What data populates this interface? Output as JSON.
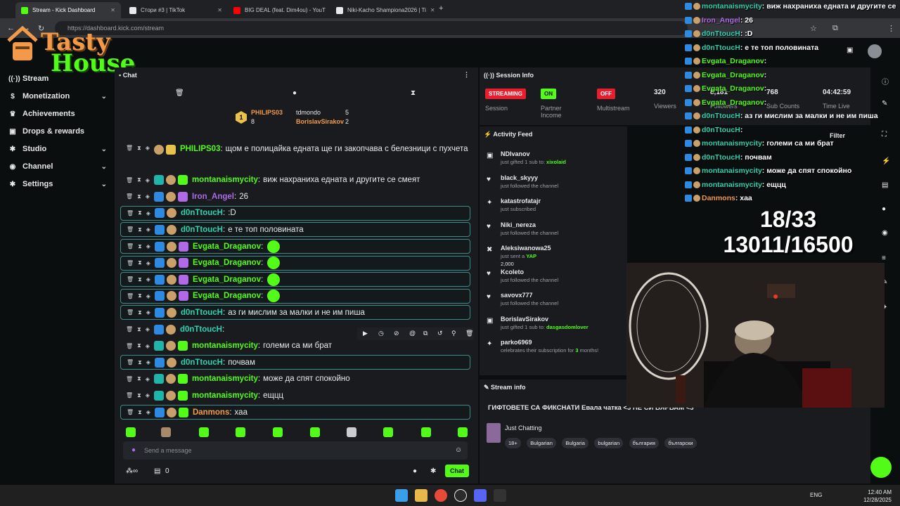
{
  "browser": {
    "tabs": [
      {
        "title": "Stream - Kick Dashboard",
        "color": "#53fc18"
      },
      {
        "title": "Стори #3 | TikTok",
        "color": "#e7e9ea"
      },
      {
        "title": "BIG DEAL (feat. Dim4ou) - YouT",
        "color": "#ff0000"
      },
      {
        "title": "Niki-Kacho Shampiona2026 | Ti",
        "color": "#e7e9ea"
      }
    ],
    "url": "https://dashboard.kick.com/stream"
  },
  "logo": {
    "line1": "Tasty",
    "line2": "House"
  },
  "sidebar": {
    "items": [
      {
        "label": "Stream",
        "icon": "broadcast-icon",
        "glyph": "((·))",
        "chevron": false
      },
      {
        "label": "Monetization",
        "icon": "dollar-icon",
        "glyph": "$",
        "chevron": true
      },
      {
        "label": "Achievements",
        "icon": "trophy-icon",
        "glyph": "♛",
        "chevron": false
      },
      {
        "label": "Drops & rewards",
        "icon": "gift-icon",
        "glyph": "▣",
        "chevron": false
      },
      {
        "label": "Studio",
        "icon": "gear-icon",
        "glyph": "✱",
        "chevron": true
      },
      {
        "label": "Channel",
        "icon": "gamepad-icon",
        "glyph": "◉",
        "chevron": true
      },
      {
        "label": "Settings",
        "icon": "settings-icon",
        "glyph": "✱",
        "chevron": true
      }
    ]
  },
  "chat": {
    "title": "Chat",
    "leaderboard": [
      {
        "rank": "1",
        "name": "PHILIPS03",
        "count": "8"
      },
      {
        "name": "tdmondo",
        "count": "5"
      },
      {
        "name": "BorislavSirakov",
        "count": "2"
      }
    ],
    "messages": [
      {
        "user": "PHILIPS03",
        "color": "u-green",
        "text": "щом е полицайка едната ще ги закопчава с белезници с пухчета",
        "hl": false,
        "badges": [
          "b-face",
          "b-gold"
        ]
      },
      {
        "user": "montanaismycity",
        "color": "u-green",
        "text": "виж нахраниха едната и другите се смеят",
        "hl": false,
        "badges": [
          "b-cyan",
          "b-face",
          "b-sub"
        ]
      },
      {
        "user": "Iron_Angel",
        "color": "u-purple",
        "text": "26",
        "hl": false,
        "badges": [
          "b-blue",
          "b-face",
          "b-purp"
        ]
      },
      {
        "user": "d0nTtoucH",
        "color": "u-cyan",
        "text": ":D",
        "hl": true,
        "badges": [
          "b-blue",
          "b-face"
        ]
      },
      {
        "user": "d0nTtoucH",
        "color": "u-cyan",
        "text": "е те топ половината",
        "hl": true,
        "badges": [
          "b-blue",
          "b-face"
        ]
      },
      {
        "user": "Evgata_Draganov",
        "color": "u-green",
        "text": "",
        "emote": true,
        "hl": true,
        "badges": [
          "b-blue",
          "b-face",
          "b-purp"
        ]
      },
      {
        "user": "Evgata_Draganov",
        "color": "u-green",
        "text": "",
        "emote": true,
        "hl": true,
        "badges": [
          "b-blue",
          "b-face",
          "b-purp"
        ]
      },
      {
        "user": "Evgata_Draganov",
        "color": "u-green",
        "text": "",
        "emote": true,
        "hl": true,
        "badges": [
          "b-blue",
          "b-face",
          "b-purp"
        ]
      },
      {
        "user": "Evgata_Draganov",
        "color": "u-green",
        "text": "",
        "emote": true,
        "hl": true,
        "badges": [
          "b-blue",
          "b-face",
          "b-purp"
        ]
      },
      {
        "user": "d0nTtoucH",
        "color": "u-cyan",
        "text": "аз ги мислим за малки и не им пиша",
        "hl": true,
        "badges": [
          "b-blue",
          "b-face"
        ]
      },
      {
        "user": "d0nTtoucH",
        "color": "u-cyan",
        "text": "",
        "hl": false,
        "badges": [
          "b-blue",
          "b-face"
        ]
      },
      {
        "user": "montanaismycity",
        "color": "u-green",
        "text": "големи са ми брат",
        "hl": false,
        "badges": [
          "b-cyan",
          "b-face",
          "b-sub"
        ]
      },
      {
        "user": "d0nTtoucH",
        "color": "u-cyan",
        "text": "почвам",
        "hl": true,
        "badges": [
          "b-blue",
          "b-face"
        ]
      },
      {
        "user": "montanaismycity",
        "color": "u-green",
        "text": "може да спят спокойно",
        "hl": false,
        "badges": [
          "b-cyan",
          "b-face",
          "b-sub"
        ]
      },
      {
        "user": "montanaismycity",
        "color": "u-green",
        "text": "ещцц",
        "hl": false,
        "badges": [
          "b-cyan",
          "b-face",
          "b-sub"
        ]
      },
      {
        "user": "Danmons",
        "color": "u-orange",
        "text": "хаа",
        "hl": true,
        "badges": [
          "b-blue",
          "b-face",
          "b-sub"
        ]
      }
    ],
    "send_placeholder": "Send a message",
    "chat_button": "Chat",
    "cart_count": "0"
  },
  "session": {
    "title": "Session Info",
    "stats": [
      {
        "pill": "STREAMING",
        "pillColor": "#e81e2e",
        "label": "Session"
      },
      {
        "pill": "ON",
        "pillColor": "#53fc18",
        "label": "Partner Income"
      },
      {
        "pill": "OFF",
        "pillColor": "#e81e2e",
        "label": "Multistream"
      },
      {
        "value": "320",
        "label": "Viewers"
      },
      {
        "value": "8,181",
        "label": "Followers"
      },
      {
        "value": "768",
        "label": "Sub Counts"
      },
      {
        "value": "04:42:59",
        "label": "Time Live"
      }
    ]
  },
  "activity": {
    "title": "Activity Feed",
    "filter": "Filter",
    "items": [
      {
        "icon": "gift-icon",
        "glyph": "▣",
        "who": "NDIvanov",
        "what": "just gifted 1 sub to: ",
        "bold": "xixolaid",
        "time": ""
      },
      {
        "icon": "heart-icon",
        "glyph": "♥",
        "who": "black_skyyy",
        "what": "just followed the channel",
        "bold": "",
        "time": "6 minutes ago"
      },
      {
        "icon": "star-icon",
        "glyph": "✦",
        "who": "katastrofatajr",
        "what": "just subscribed",
        "bold": "",
        "time": "32 minutes ago"
      },
      {
        "icon": "heart-icon",
        "glyph": "♥",
        "who": "Niki_nereza",
        "what": "just followed the channel",
        "bold": "",
        "time": "33 minutes ago"
      },
      {
        "icon": "kick-icon",
        "glyph": "✖",
        "who": "Aleksiwanowa25",
        "what": "just sent a ",
        "bold": "YAP",
        "extra": "2,000",
        "time": "1 hour ago"
      },
      {
        "icon": "heart-icon",
        "glyph": "♥",
        "who": "Kcoleto",
        "what": "just followed the channel",
        "bold": "",
        "time": ""
      },
      {
        "icon": "heart-icon",
        "glyph": "♥",
        "who": "savovx777",
        "what": "just followed the channel",
        "bold": "",
        "time": ""
      },
      {
        "icon": "gift-icon",
        "glyph": "▣",
        "who": "BorislavSirakov",
        "what": "just gifted 1 sub to: ",
        "bold": "dasgasdomlover",
        "time": ""
      },
      {
        "icon": "star-icon",
        "glyph": "✦",
        "who": "parko6969",
        "what": "celebrates their subscription for ",
        "bold": "3",
        "tail": " months!",
        "time": ""
      }
    ]
  },
  "stream_info": {
    "title": "Stream info",
    "stream_title": "ГИФТОВЕТЕ СА ФИКСНАТИ Евала чатка <3 НЕ СИ ВЯРВАМ <3",
    "category": "Just Chatting",
    "tags": [
      "18+",
      "Bulgarian",
      "Bulgaria",
      "bulgarian",
      "българия",
      "български"
    ]
  },
  "overlay_chat": [
    {
      "user": "montanaismycity",
      "text": ": виж нахраниха едната и другите се"
    },
    {
      "user": "Iron_Angel",
      "text": ": 26",
      "color": "#b06ae8"
    },
    {
      "user": "d0nTtoucH",
      "text": ": :D"
    },
    {
      "user": "d0nTtoucH",
      "text": ": е те топ половината"
    },
    {
      "user": "Evgata_Draganov",
      "text": ":",
      "color": "#53fc18"
    },
    {
      "user": "Evgata_Draganov",
      "text": ":",
      "color": "#53fc18"
    },
    {
      "user": "Evgata_Draganov",
      "text": ":",
      "color": "#53fc18"
    },
    {
      "user": "Evgata_Draganov",
      "text": ":",
      "color": "#53fc18"
    },
    {
      "user": "d0nTtoucH",
      "text": ": аз ги мислим за малки и не им пиша"
    },
    {
      "user": "d0nTtoucH",
      "text": ":"
    },
    {
      "user": "montanaismycity",
      "text": ": големи са ми брат"
    },
    {
      "user": "d0nTtoucH",
      "text": ": почвам"
    },
    {
      "user": "montanaismycity",
      "text": ": може да спят спокойно"
    },
    {
      "user": "montanaismycity",
      "text": ": ещцц"
    },
    {
      "user": "Danmons",
      "text": ": хаа",
      "color": "#f29a4a"
    }
  ],
  "goal": {
    "line1": "18/33",
    "line2": "13011/16500"
  },
  "taskbar": {
    "lang": "ENG",
    "time": "12:40 AM",
    "date": "12/28/2025"
  }
}
